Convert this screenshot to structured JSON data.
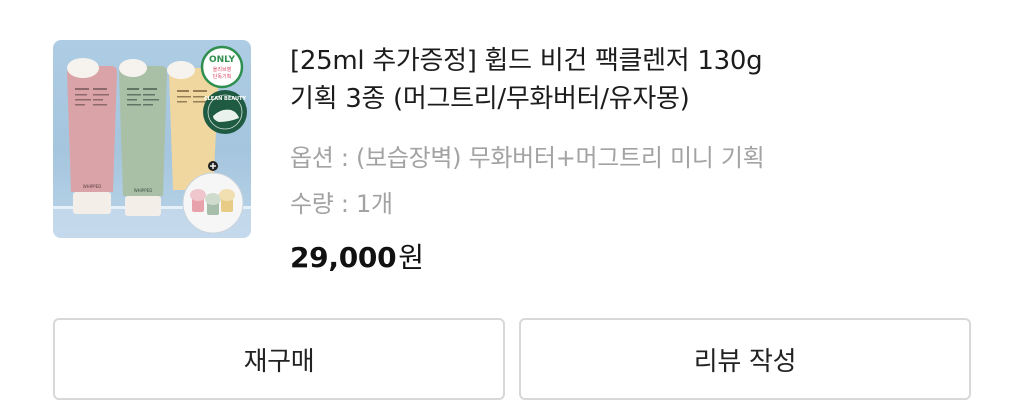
{
  "product": {
    "title_line1": "[25ml 추가증정] 휩드 비건 팩클렌저 130g",
    "title_line2": "기획 3종 (머그트리/무화버터/유자몽)",
    "option": "옵션 : (보습장벽) 무화버터+머그트리 미니 기획",
    "quantity": "수량 : 1개",
    "price_number": "29,000",
    "price_unit": "원",
    "image": {
      "badge_only": "ONLY",
      "badge_only_sub1": "올리브영",
      "badge_only_sub2": "단독기획",
      "badge_clean": "CLEAN BEAUTY",
      "tube_label": "WHIPPED",
      "colors": {
        "pink_tube": "#d9a3a8",
        "green_tube": "#a9bfa6",
        "yellow_tube": "#efd79f",
        "only_badge_green": "#2f8f4e",
        "clean_badge_green": "#1f5a43"
      }
    }
  },
  "actions": {
    "reorder_label": "재구매",
    "review_label": "리뷰 작성"
  }
}
